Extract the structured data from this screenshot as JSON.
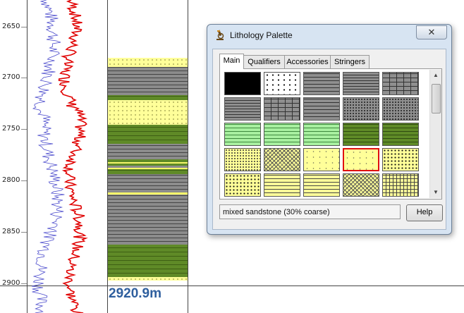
{
  "well_log": {
    "depth_labels": [
      "2650",
      "2700",
      "2750",
      "2800",
      "2850",
      "2900"
    ],
    "depth_readout": "2920.9m",
    "colors": {
      "curve_blue": "#4a4acc",
      "curve_red": "#e00000",
      "readout": "#2f5f9e"
    }
  },
  "dialog": {
    "title": "Lithology Palette",
    "close_label": "✕",
    "tabs": [
      "Main",
      "Qualifiers",
      "Accessories",
      "Stringers"
    ],
    "active_tab": "Main",
    "swatch_rows": [
      [
        "black",
        "white-dots",
        "gray-dash",
        "gray-line",
        "gray-brick"
      ],
      [
        "gray-line",
        "gray-brick",
        "gray-dash",
        "gray-speck",
        "gray-speck"
      ],
      [
        "green",
        "green",
        "green",
        "olive",
        "olive"
      ],
      [
        "yellow-dots",
        "yellow-cross",
        "yellow-sparse",
        "yellow-sparse",
        "yellow-dense"
      ],
      [
        "yellow-dense",
        "yellow-dash",
        "yellow-dash",
        "yellow-cross",
        "yellow-grid"
      ]
    ],
    "selected_swatch": "row 4, column 4",
    "status_text": "mixed sandstone (30% coarse)",
    "help_label": "Help",
    "scroll_up_icon": "▲",
    "scroll_down_icon": "▼"
  }
}
